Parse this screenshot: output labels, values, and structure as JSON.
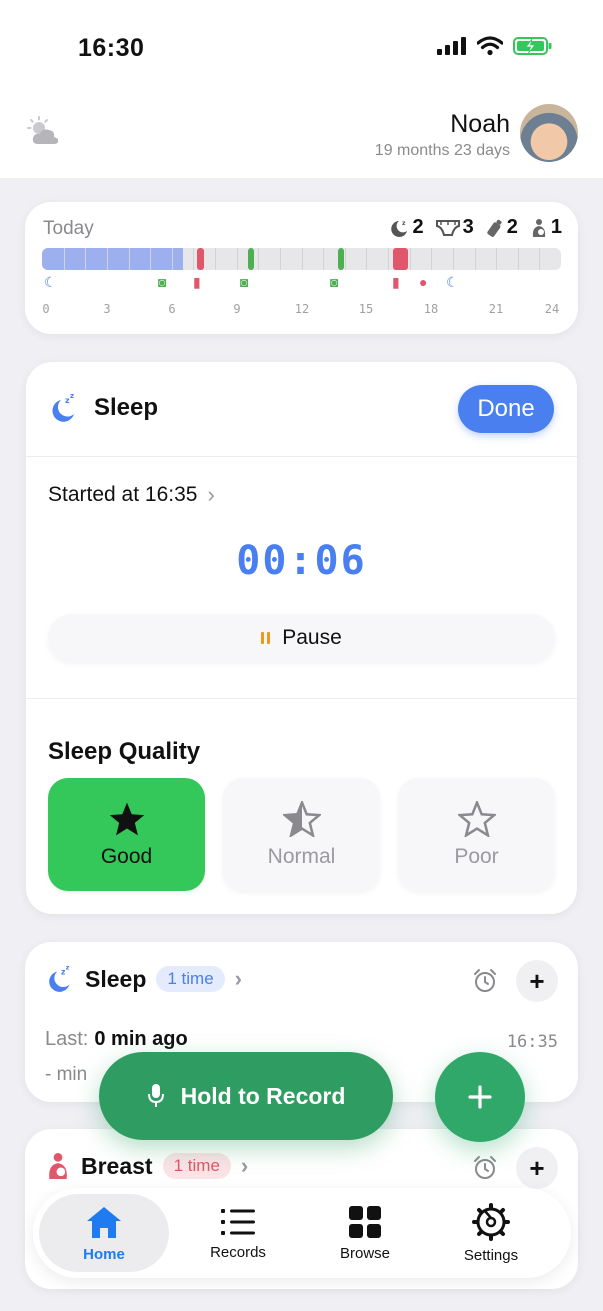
{
  "status_bar": {
    "time": "16:30"
  },
  "profile": {
    "name": "Noah",
    "age": "19 months 23 days"
  },
  "today": {
    "label": "Today",
    "counts": [
      {
        "icon": "sleep-moon-icon",
        "value": "2"
      },
      {
        "icon": "diaper-icon",
        "value": "3"
      },
      {
        "icon": "bottle-icon",
        "value": "2"
      },
      {
        "icon": "breastfeed-icon",
        "value": "1"
      }
    ],
    "ticks": [
      "0",
      "3",
      "6",
      "9",
      "12",
      "15",
      "18",
      "21",
      "24"
    ]
  },
  "sleep_card": {
    "title": "Sleep",
    "done_label": "Done",
    "started": "Started at 16:35",
    "timer": "00:06",
    "pause_label": "Pause",
    "quality_title": "Sleep Quality",
    "quality_options": [
      "Good",
      "Normal",
      "Poor"
    ],
    "selected_quality": "Good"
  },
  "records": [
    {
      "title": "Sleep",
      "badge": "1 time",
      "last_label": "Last:",
      "last_value": "0 min  ago",
      "time": "16:35",
      "sub": "- min"
    },
    {
      "title": "Breast",
      "badge": "1 time"
    }
  ],
  "record_button": {
    "label": "Hold to Record"
  },
  "tabs": [
    {
      "label": "Home",
      "icon": "home-icon",
      "active": true
    },
    {
      "label": "Records",
      "icon": "list-icon",
      "active": false
    },
    {
      "label": "Browse",
      "icon": "grid-icon",
      "active": false
    },
    {
      "label": "Settings",
      "icon": "gear-icon",
      "active": false
    }
  ],
  "colors": {
    "accent_blue": "#4a7ff0",
    "good_green": "#34c759",
    "record_green": "#2f9d62",
    "feeding_red": "#e0566a",
    "diaper_green": "#4caf50",
    "timer_orange": "#f0961e"
  }
}
